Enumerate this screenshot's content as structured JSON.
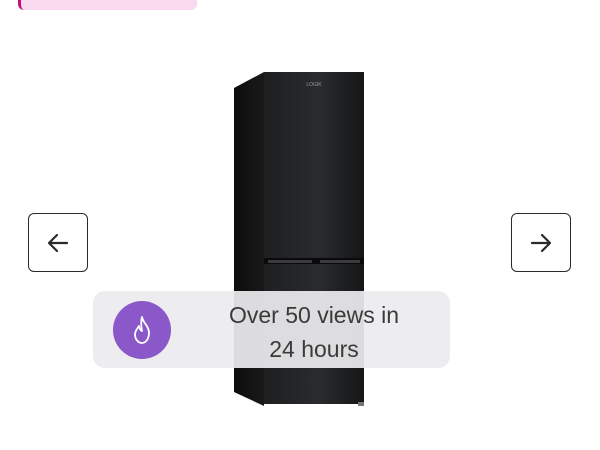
{
  "product": {
    "brand_mark": "LOGIK"
  },
  "gallery": {
    "prev_icon": "arrow-left-icon",
    "next_icon": "arrow-right-icon"
  },
  "views_toast": {
    "icon": "flame-icon",
    "line1": "Over 50 views in",
    "line2": "24 hours",
    "icon_bg": "#8b58c9"
  },
  "colors": {
    "badge_bg": "#fbd9ee",
    "badge_accent": "#c2127a"
  }
}
